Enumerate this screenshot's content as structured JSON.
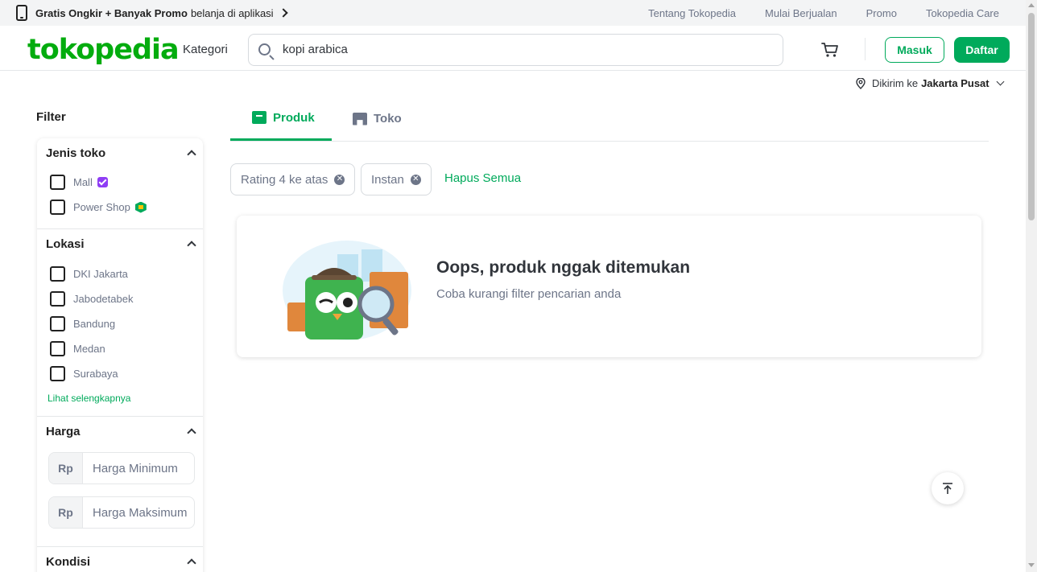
{
  "promo_bar": {
    "bold_text": "Gratis Ongkir + Banyak Promo",
    "text": "belanja di aplikasi",
    "links": [
      "Tentang Tokopedia",
      "Mulai Berjualan",
      "Promo",
      "Tokopedia Care"
    ]
  },
  "header": {
    "logo": "tokopedia",
    "kategori": "Kategori",
    "search_value": "kopi arabica",
    "login_label": "Masuk",
    "register_label": "Daftar"
  },
  "location": {
    "prefix": "Dikirim ke",
    "city": "Jakarta Pusat"
  },
  "filter": {
    "title": "Filter",
    "jenis_toko": {
      "title": "Jenis toko",
      "options": [
        "Mall",
        "Power Shop"
      ]
    },
    "lokasi": {
      "title": "Lokasi",
      "options": [
        "DKI Jakarta",
        "Jabodetabek",
        "Bandung",
        "Medan",
        "Surabaya"
      ],
      "see_more": "Lihat selengkapnya"
    },
    "harga": {
      "title": "Harga",
      "currency": "Rp",
      "min_placeholder": "Harga Minimum",
      "max_placeholder": "Harga Maksimum"
    },
    "kondisi": {
      "title": "Kondisi"
    }
  },
  "tabs": [
    "Produk",
    "Toko"
  ],
  "active_filters": {
    "chips": [
      "Rating 4 ke atas",
      "Instan"
    ],
    "clear_all": "Hapus Semua"
  },
  "empty_state": {
    "title": "Oops, produk nggak ditemukan",
    "subtitle": "Coba kurangi filter pencarian anda"
  },
  "colors": {
    "brand_green": "#00aa5b",
    "logo_green": "#03ac0e",
    "text_gray": "#6d7588"
  }
}
